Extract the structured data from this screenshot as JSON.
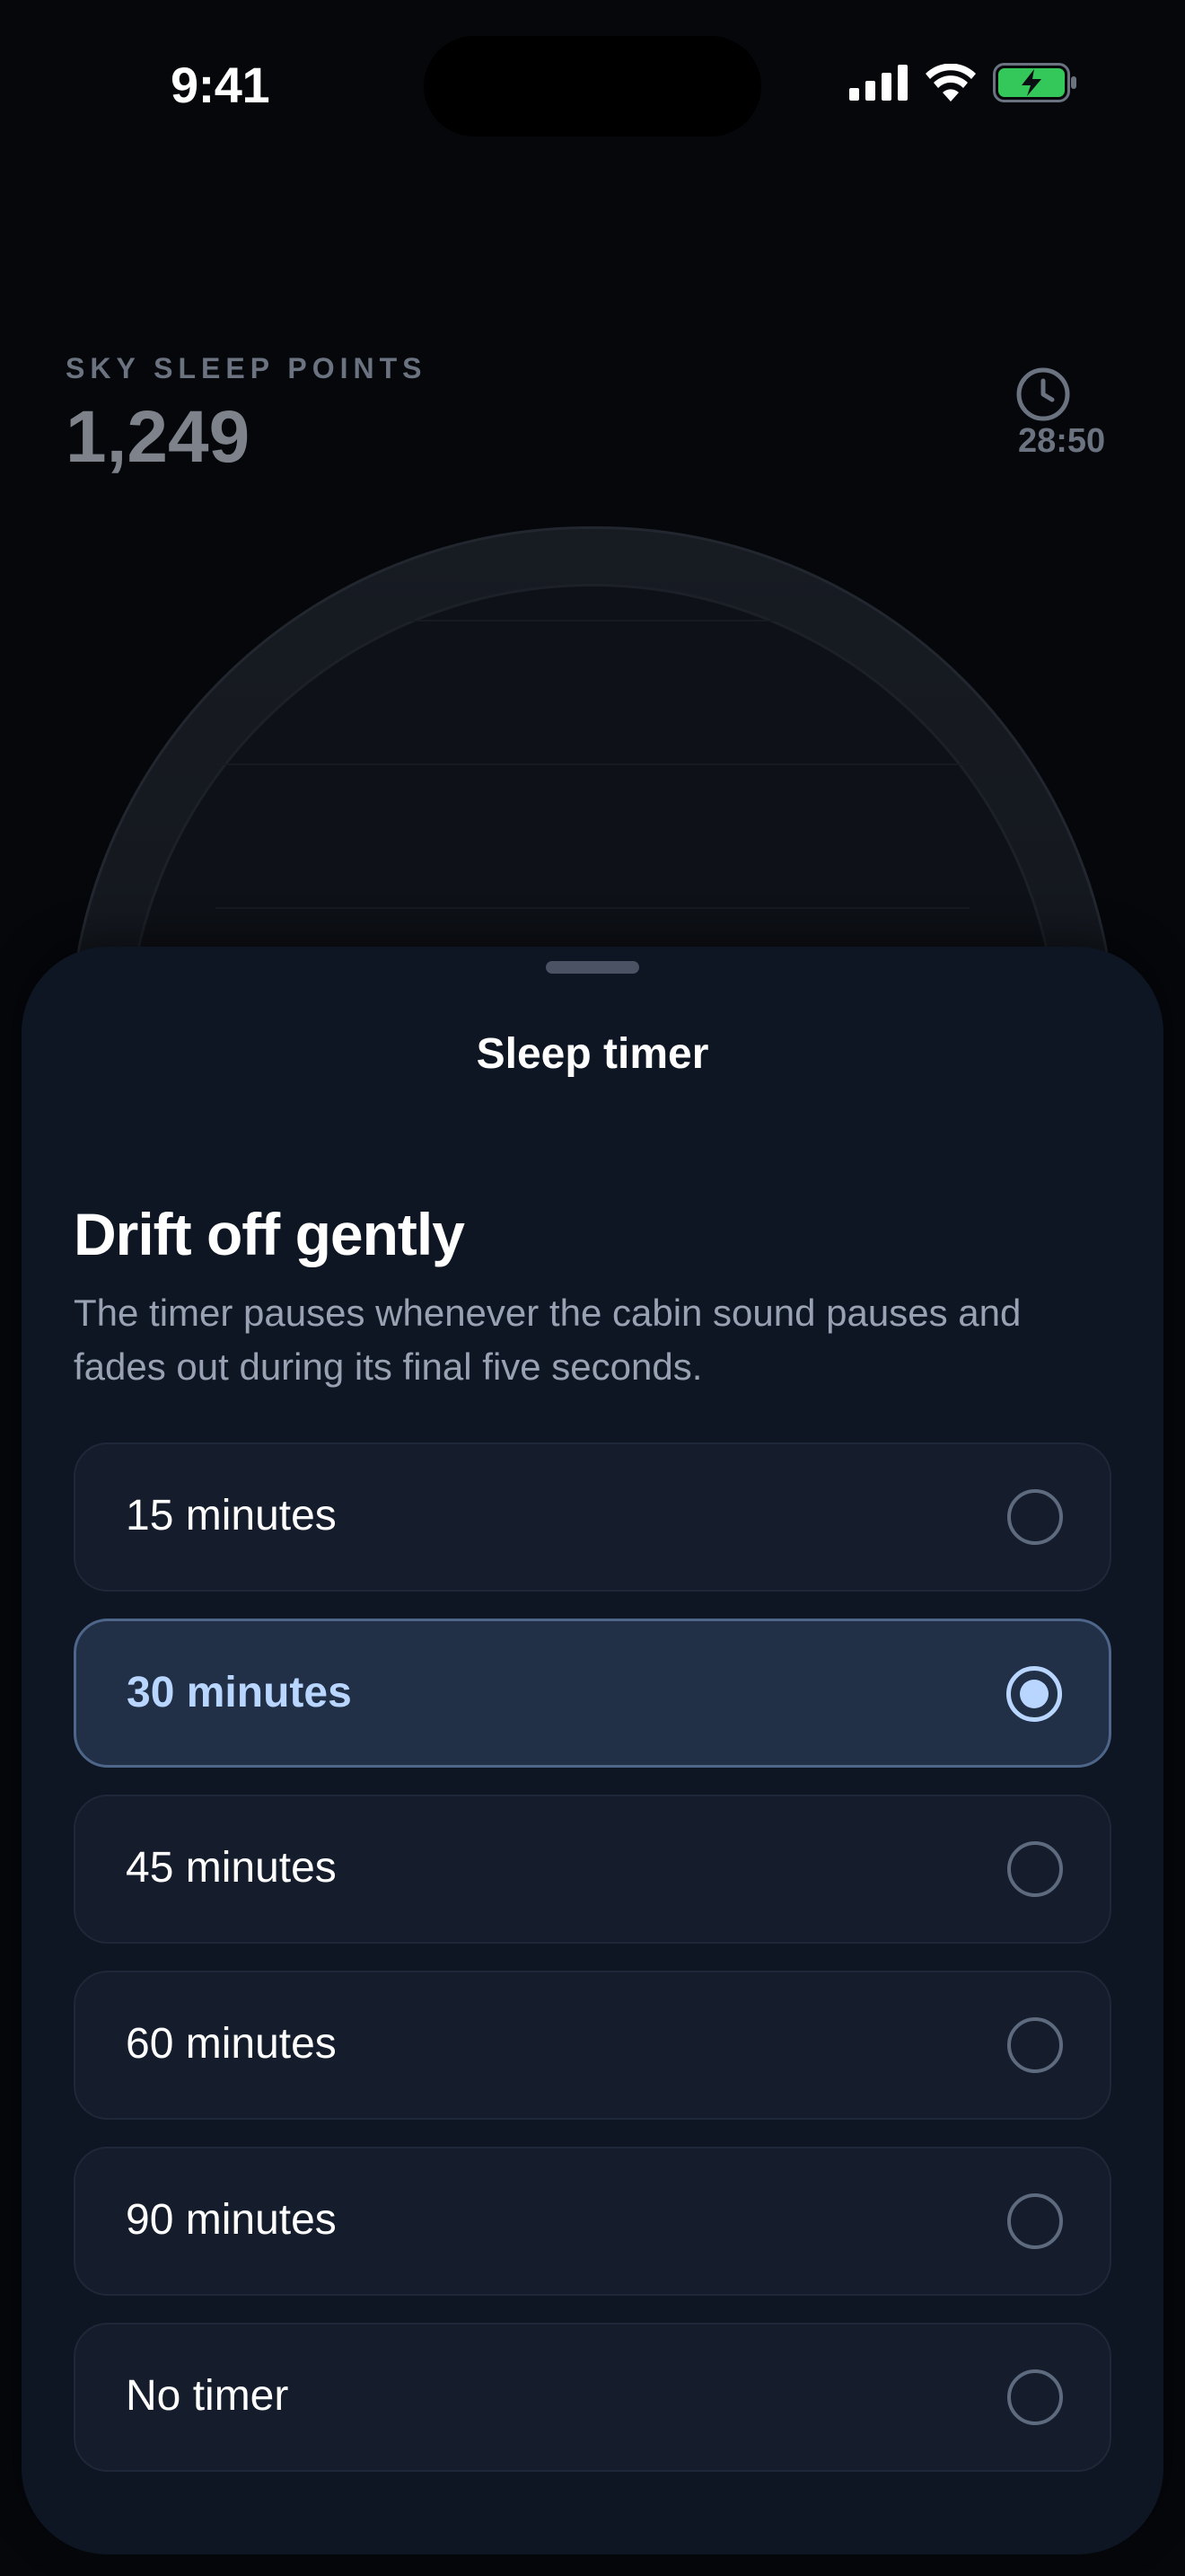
{
  "status_bar": {
    "time": "9:41"
  },
  "game": {
    "points_label": "SKY SLEEP POINTS",
    "points_value": "1,249",
    "timer_value": "28:50"
  },
  "sheet": {
    "title": "Sleep timer",
    "heading": "Drift off gently",
    "description": "The timer pauses whenever the cabin sound pauses and fades out during its final five seconds.",
    "options": [
      {
        "label": "15 minutes",
        "selected": false
      },
      {
        "label": "30 minutes",
        "selected": true
      },
      {
        "label": "45 minutes",
        "selected": false
      },
      {
        "label": "60 minutes",
        "selected": false
      },
      {
        "label": "90 minutes",
        "selected": false
      },
      {
        "label": "No timer",
        "selected": false
      }
    ]
  },
  "colors": {
    "accent": "#b8d6ff",
    "battery": "#34c759",
    "sheet_background": "#0f1623"
  }
}
